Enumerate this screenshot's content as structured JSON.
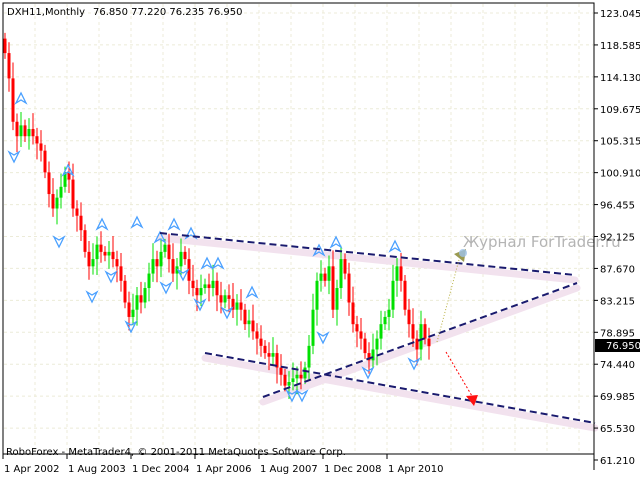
{
  "header": {
    "symbol": "DXH11,Monthly",
    "ohlc": "76.850 77.220 76.235 76.950"
  },
  "watermark": "Журнал ForTrader.ru",
  "footer": "RoboForex - MetaTrader4, © 2001-2011 MetaQuotes Software Corp.",
  "current_price": "76.950",
  "colors": {
    "bull": "#00e000",
    "bear": "#ff0000",
    "trendline": "#1a1a6e",
    "fractal": "#4aa0ff",
    "grid": "#ecebd8"
  },
  "chart_data": {
    "type": "candlestick",
    "title": "DXH11,Monthly",
    "y_ticks": [
      "123.045",
      "118.585",
      "114.130",
      "109.675",
      "105.315",
      "100.910",
      "96.455",
      "92.125",
      "87.670",
      "83.215",
      "78.895",
      "74.440",
      "69.985",
      "65.530",
      "61.210"
    ],
    "ylim": [
      61.21,
      123.045
    ],
    "x_ticks": [
      "1 Apr 2002",
      "1 Aug 2003",
      "1 Dec 2004",
      "1 Apr 2006",
      "1 Aug 2007",
      "1 Dec 2008",
      "1 Apr 2010"
    ],
    "first_bar": "Apr 2002",
    "closes": [
      117.5,
      114,
      108,
      106,
      107.5,
      106,
      107,
      106,
      105,
      104,
      101,
      98,
      96,
      97.5,
      99,
      101,
      100,
      96,
      95,
      93,
      90,
      88,
      89,
      91,
      90,
      89.5,
      90,
      89,
      88,
      86,
      83,
      81,
      82,
      84,
      83,
      85,
      87,
      89,
      88,
      90,
      91,
      89,
      87,
      88,
      90,
      89,
      86,
      85,
      84,
      85,
      85.5,
      85,
      86,
      84,
      83,
      84,
      83.5,
      82,
      83,
      82,
      80,
      80.5,
      79,
      78,
      77,
      76,
      75.5,
      76,
      74,
      73,
      71.5,
      72,
      72.5,
      73,
      72.5,
      74,
      77,
      82,
      86,
      87,
      86,
      88,
      82,
      85,
      89,
      87,
      83,
      80,
      79,
      78,
      76,
      75,
      76.5,
      78,
      80,
      81,
      82,
      86,
      88,
      86,
      82,
      80,
      78,
      76.5,
      80,
      78,
      76.95
    ],
    "first_open": 119.5,
    "trendlines": [
      {
        "name": "upper-channel",
        "from": [
          "Dec 2004",
          92.5
        ],
        "to": [
          "Jan 2013",
          86.7
        ]
      },
      {
        "name": "support",
        "from": [
          "Apr 2008",
          69.8
        ],
        "to": [
          "Dec 2013",
          81.6
        ]
      },
      {
        "name": "lower-channel",
        "from": [
          "Apr 2006",
          75.7
        ],
        "to": [
          "Mar 2014",
          66.0
        ]
      }
    ]
  }
}
